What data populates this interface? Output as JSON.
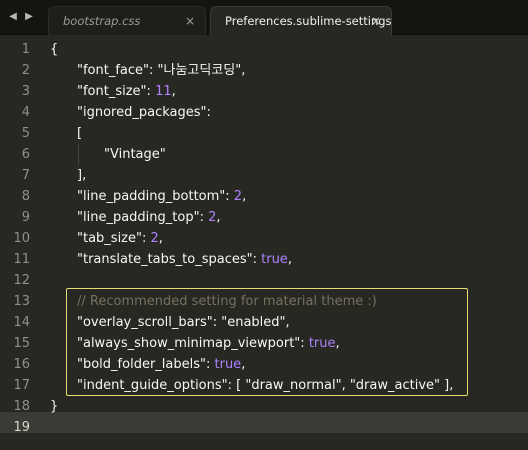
{
  "tabs": [
    {
      "label": "bootstrap.css",
      "close": "×",
      "active": false
    },
    {
      "label": "Preferences.sublime-settings",
      "close": "×",
      "active": true
    }
  ],
  "nav": {
    "back": "◀",
    "forward": "▶"
  },
  "line_numbers": [
    "1",
    "2",
    "3",
    "4",
    "5",
    "6",
    "7",
    "8",
    "9",
    "10",
    "11",
    "12",
    "13",
    "14",
    "15",
    "16",
    "17",
    "18",
    "19"
  ],
  "code": {
    "l1_brace": "{",
    "l2_key": "\"font_face\"",
    "l2_sep": ": ",
    "l2_val": "\"나눔고딕코딩\"",
    "l2_end": ",",
    "l3_key": "\"font_size\"",
    "l3_sep": ": ",
    "l3_val": "11",
    "l3_end": ",",
    "l4_key": "\"ignored_packages\"",
    "l4_sep": ":",
    "l5_bracket": "[",
    "l6_val": "\"Vintage\"",
    "l7_bracket": "],",
    "l8_key": "\"line_padding_bottom\"",
    "l8_sep": ": ",
    "l8_val": "2",
    "l8_end": ",",
    "l9_key": "\"line_padding_top\"",
    "l9_sep": ": ",
    "l9_val": "2",
    "l9_end": ",",
    "l10_key": "\"tab_size\"",
    "l10_sep": ": ",
    "l10_val": "2",
    "l10_end": ",",
    "l11_key": "\"translate_tabs_to_spaces\"",
    "l11_sep": ": ",
    "l11_val": "true",
    "l11_end": ",",
    "l13_comment": "// Recommended setting for material theme :)",
    "l14_key": "\"overlay_scroll_bars\"",
    "l14_sep": ": ",
    "l14_val": "\"enabled\"",
    "l14_end": ",",
    "l15_key": "\"always_show_minimap_viewport\"",
    "l15_sep": ": ",
    "l15_val": "true",
    "l15_end": ",",
    "l16_key": "\"bold_folder_labels\"",
    "l16_sep": ": ",
    "l16_val": "true",
    "l16_end": ",",
    "l17_key": "\"indent_guide_options\"",
    "l17_sep": ": ",
    "l17_val": "[ \"draw_normal\", \"draw_active\" ]",
    "l17_end": ",",
    "l18_brace": "}"
  },
  "colors": {
    "background": "#272822",
    "number": "#ae81ff",
    "comment": "#75715e",
    "find_highlight": "#e6db74"
  }
}
